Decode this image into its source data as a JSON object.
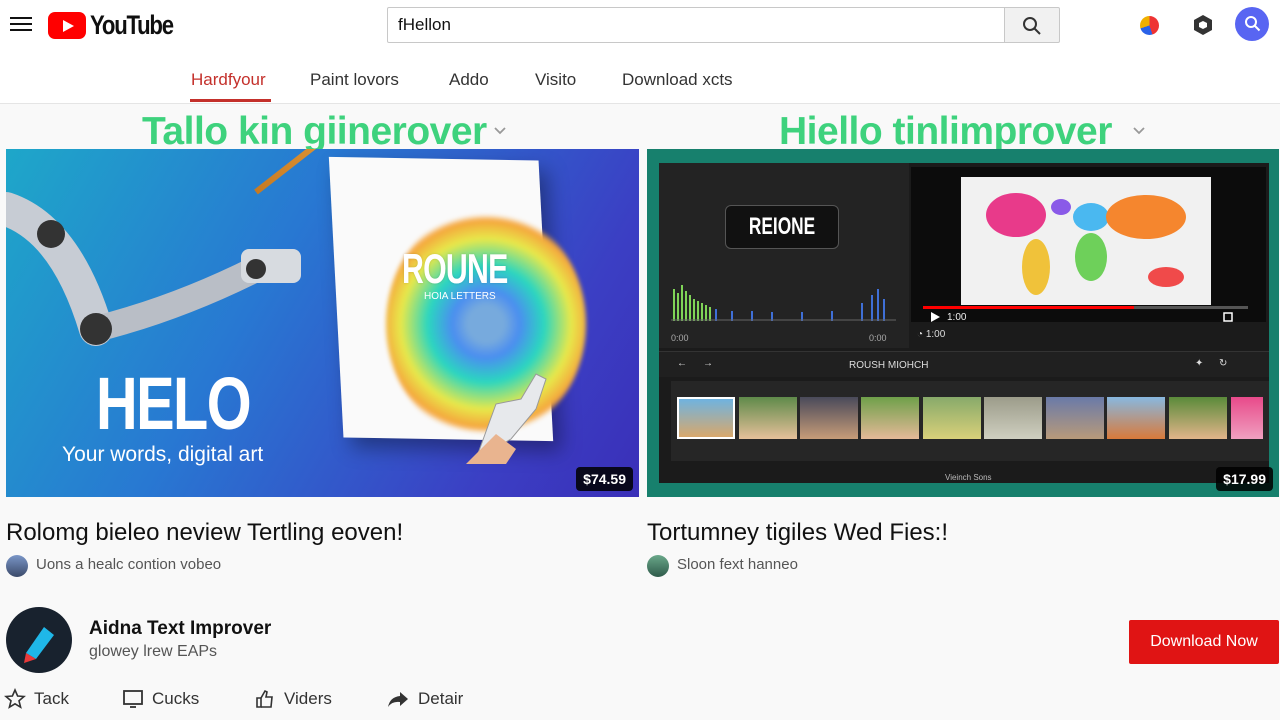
{
  "header": {
    "logo_text": "YouTube",
    "search_value": "fHellon"
  },
  "tabs": [
    {
      "label": "Hardfyour",
      "active": true
    },
    {
      "label": "Paint lovors"
    },
    {
      "label": "Addo"
    },
    {
      "label": "Visito"
    },
    {
      "label": "Download xcts"
    }
  ],
  "videos": [
    {
      "headline": "Tallo kin giinerover",
      "thumb_canvas_text": "ROUNE",
      "thumb_canvas_sub": "HOIA LETTERS",
      "thumb_big_text": "HELO",
      "thumb_sub_text": "Your words, digital art",
      "price": "$74.59",
      "title": "Rolomg bieleo neview Tertling eoven!",
      "meta": "Uons a healc contion vobeo"
    },
    {
      "headline": "Hiello tinlimprover",
      "editor_badge": "REIONE",
      "editor_toolbar_label": "ROUSH MIOHCH",
      "editor_time_left": "0:00",
      "editor_time_right": "0:00",
      "editor_player_time": "1:00",
      "editor_footer": "Vieinch Sons",
      "price": "$17.99",
      "title": "Tortumney tigiles Wed Fies:!",
      "meta": "Sloon fext hanneo"
    }
  ],
  "channel": {
    "name": "Aidna Text Improver",
    "subtitle": "glowey lrew EAPs",
    "cta": "Download Now"
  },
  "actions": [
    {
      "label": "Tack",
      "icon": "star-icon"
    },
    {
      "label": "Cucks",
      "icon": "window-icon"
    },
    {
      "label": "Viders",
      "icon": "thumbs-up-icon"
    },
    {
      "label": "Detair",
      "icon": "share-icon"
    }
  ],
  "colors": {
    "brand": "#ff0000",
    "accent_tab": "#c4302b",
    "headline": "#2fcf73",
    "cta": "#e01414"
  }
}
